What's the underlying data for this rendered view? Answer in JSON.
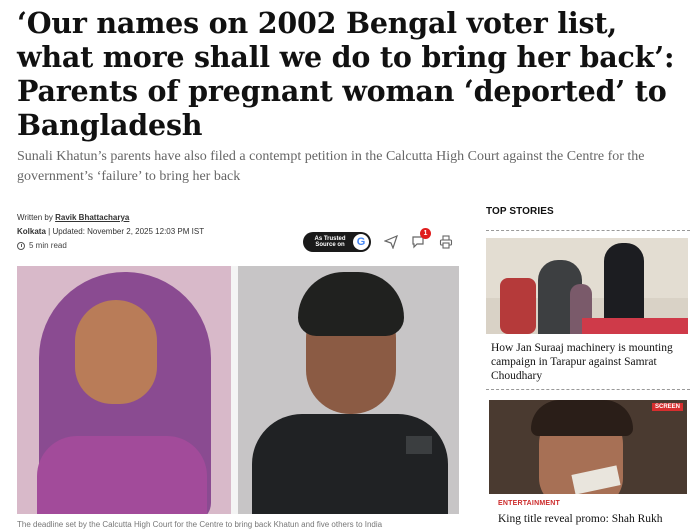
{
  "article": {
    "headline": "‘Our names on 2002 Bengal voter list, what more shall we do to bring her back’: Parents of pregnant woman ‘deported’ to Bangladesh",
    "dek": "Sunali Khatun’s parents have also filed a contempt petition in the Calcutta High Court against the Centre for the government’s ‘failure’ to bring her back",
    "byline_prefix": "Written by",
    "author": "Ravik Bhattacharya",
    "city": "Kolkata",
    "updated": "| Updated: November 2, 2025 12:03 PM IST",
    "read_time": "5 min read",
    "caption": "The deadline set by the Calcutta High Court for the Centre to bring back Khatun and five others to India"
  },
  "toolbar": {
    "trusted_source_label": "As Trusted Source on",
    "google_glyph": "G",
    "notification_count": "1",
    "share_icon": "share-icon",
    "comment_icon": "comment-icon",
    "print_icon": "print-icon"
  },
  "sidebar": {
    "heading": "TOP STORIES",
    "stories": [
      {
        "title": "How Jan Suraaj machinery is mounting campaign in Tarapur against Samrat Choudhary"
      },
      {
        "category": "ENTERTAINMENT",
        "badge": "SCREEN",
        "title": "King title reveal promo: Shah Rukh"
      }
    ]
  },
  "colors": {
    "accent_red": "#e01e1e",
    "category_red": "#cc2b2b",
    "dek_gray": "#666666"
  }
}
